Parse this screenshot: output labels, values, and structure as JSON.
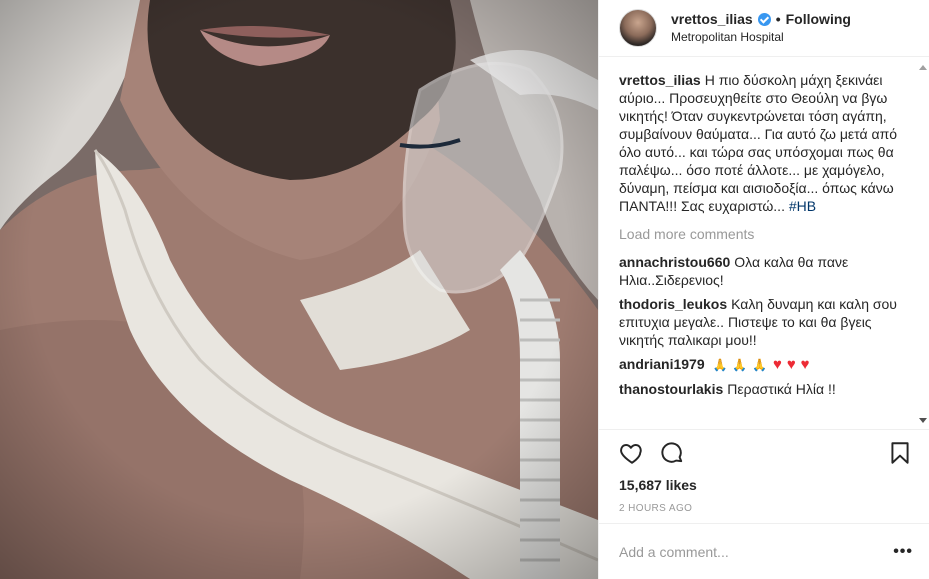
{
  "header": {
    "username": "vrettos_ilias",
    "separator": "•",
    "follow_status": "Following",
    "location": "Metropolitan Hospital"
  },
  "caption": {
    "username": "vrettos_ilias",
    "text": "Η πιο δύσκολη μάχη ξεκινάει αύριο... Προσευχηθείτε στο Θεούλη να βγω νικητής! Όταν συγκεντρώνεται τόση αγάπη, συμβαίνουν θαύματα... Για αυτό ζω μετά από όλο αυτό... και τώρα σας υπόσχομαι πως θα παλέψω... όσο ποτέ άλλοτε... με χαμόγελο, δύναμη, πείσμα και αισιοδοξία... όπως κάνω ΠΑΝΤΑ!!! Σας ευχαριστώ...",
    "hashtag": "#HB"
  },
  "load_more": "Load more comments",
  "comments": [
    {
      "username": "annachristou660",
      "text": "Ολα καλα θα πανε Ηλια..Σιδερενιος!"
    },
    {
      "username": "thodoris_leukos",
      "text": "Καλη δυναμη και καλη σου επιτυχια μεγαλε.. Πιστεψε το και θα βγεις νικητής παλικαρι μου!!"
    },
    {
      "username": "andriani1979",
      "text": ""
    },
    {
      "username": "thanostourlakis",
      "text": "Περαστικά Ηλία !!"
    }
  ],
  "emoji": {
    "pray": "🙏",
    "heart": "♥"
  },
  "likes": "15,687 likes",
  "time_ago": "2 HOURS AGO",
  "add_comment": {
    "placeholder": "Add a comment..."
  },
  "more_options": "•••",
  "icons": {
    "like": "heart-outline-icon",
    "comment": "comment-bubble-icon",
    "save": "bookmark-icon",
    "verified": "verified-badge-icon"
  },
  "colors": {
    "verified": "#3897f0",
    "hashtag": "#003569",
    "muted": "#999999",
    "heart": "#ed2b35"
  }
}
